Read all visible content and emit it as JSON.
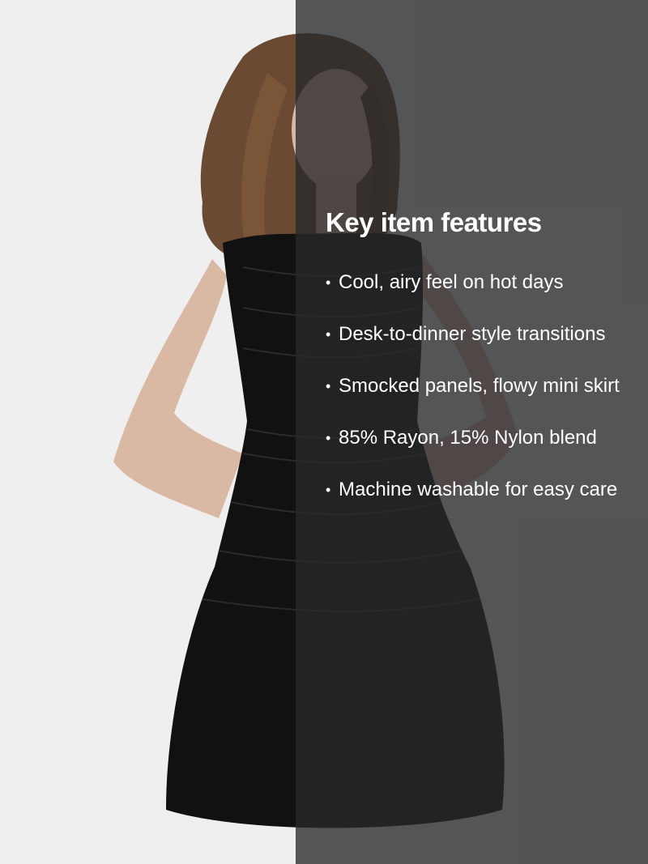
{
  "features": {
    "title": "Key item features",
    "items": [
      "Cool, airy feel on hot days",
      "Desk-to-dinner style transitions",
      "Smocked panels, flowy mini skirt",
      "85% Rayon, 15% Nylon blend",
      "Machine washable for easy care"
    ]
  },
  "colors": {
    "background": "#efefef",
    "overlay": "#3b3c3f",
    "dress": "#111111",
    "hair": "#6b4a33",
    "skin": "#d9b8a4",
    "text": "#ffffff"
  }
}
